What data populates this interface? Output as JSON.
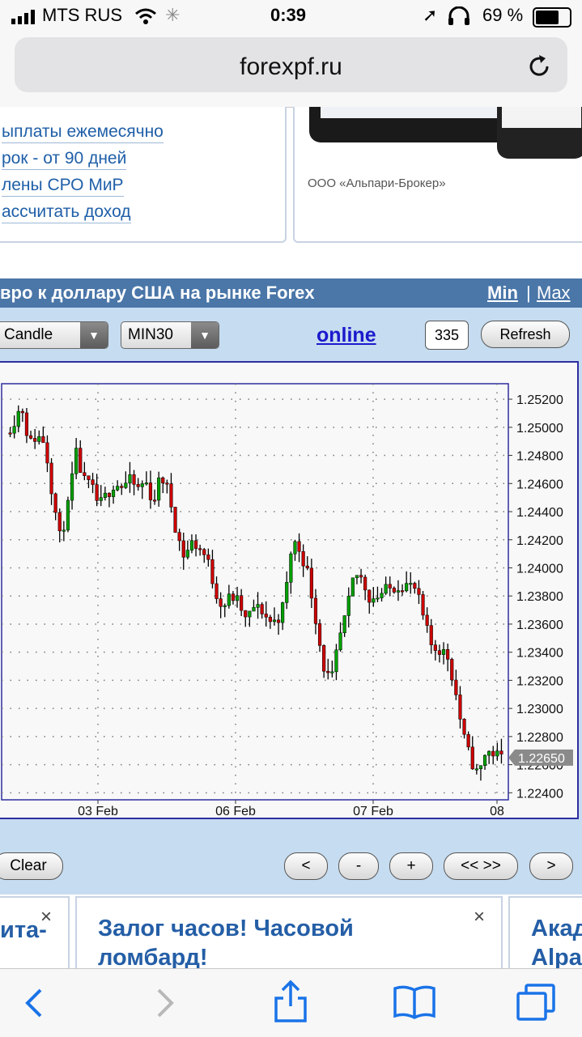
{
  "status_bar": {
    "carrier": "MTS RUS",
    "time": "0:39",
    "battery": "69 %"
  },
  "browser": {
    "url": "forexpf.ru",
    "reload_icon": "reload-icon"
  },
  "promo": {
    "links": [
      "ыплаты ежемесячно",
      "рок - от 90 дней",
      "лены СРО МиР",
      "ассчитать доход"
    ],
    "broker": "ООО «Альпари-Брокер»"
  },
  "widget": {
    "title": "вро к доллару США на рынке Forex",
    "min_label": "Min",
    "separator": "|",
    "max_label": "Max",
    "chart_type": "Candle",
    "period": "MIN30",
    "online_label": "online",
    "bars_count": "335",
    "refresh_label": "Refresh",
    "clear_label": "Clear",
    "nav": {
      "prev": "<",
      "zoom_out": "-",
      "zoom_in": "+",
      "fit": "<< >>",
      "next": ">"
    }
  },
  "chart_data": {
    "type": "candlestick",
    "x_ticks": [
      "03 Feb",
      "06 Feb",
      "07 Feb",
      "08"
    ],
    "y_ticks": [
      "1.25200",
      "1.25000",
      "1.24800",
      "1.24600",
      "1.24400",
      "1.24200",
      "1.24000",
      "1.23800",
      "1.23600",
      "1.23400",
      "1.23200",
      "1.23000",
      "1.22800",
      "1.22600",
      "1.22400"
    ],
    "ylim": [
      1.2235,
      1.2531
    ],
    "current_price": "1.22650",
    "current_value": 1.2265,
    "grid": true,
    "colors": {
      "up": "#00a000",
      "down": "#cc0000",
      "wick": "#000000",
      "border": "#2222aa"
    },
    "path": [
      1.2496,
      1.2504,
      1.2516,
      1.2488,
      1.2494,
      1.249,
      1.2452,
      1.242,
      1.2444,
      1.2482,
      1.2462,
      1.2458,
      1.2444,
      1.2452,
      1.246,
      1.2458,
      1.2462,
      1.2456,
      1.2462,
      1.2446,
      1.2466,
      1.2454,
      1.2426,
      1.2408,
      1.2418,
      1.2414,
      1.2406,
      1.2384,
      1.2372,
      1.238,
      1.2376,
      1.2362,
      1.2372,
      1.237,
      1.2362,
      1.2362,
      1.2376,
      1.242,
      1.2412,
      1.2396,
      1.2364,
      1.233,
      1.2318,
      1.2348,
      1.2368,
      1.2396,
      1.2392,
      1.2378,
      1.238,
      1.2384,
      1.2386,
      1.2388,
      1.2388,
      1.2384,
      1.2362,
      1.2344,
      1.2342,
      1.2338,
      1.2314,
      1.2282,
      1.2264,
      1.2252,
      1.227,
      1.2268,
      1.2265
    ]
  },
  "ads": [
    {
      "title": "ита-",
      "close": "×"
    },
    {
      "title_line1": "Залог часов! Часовой",
      "title_line2": "ломбард!",
      "close": "×"
    },
    {
      "title_line1": "Акад",
      "title_line2": "Alpa"
    }
  ]
}
